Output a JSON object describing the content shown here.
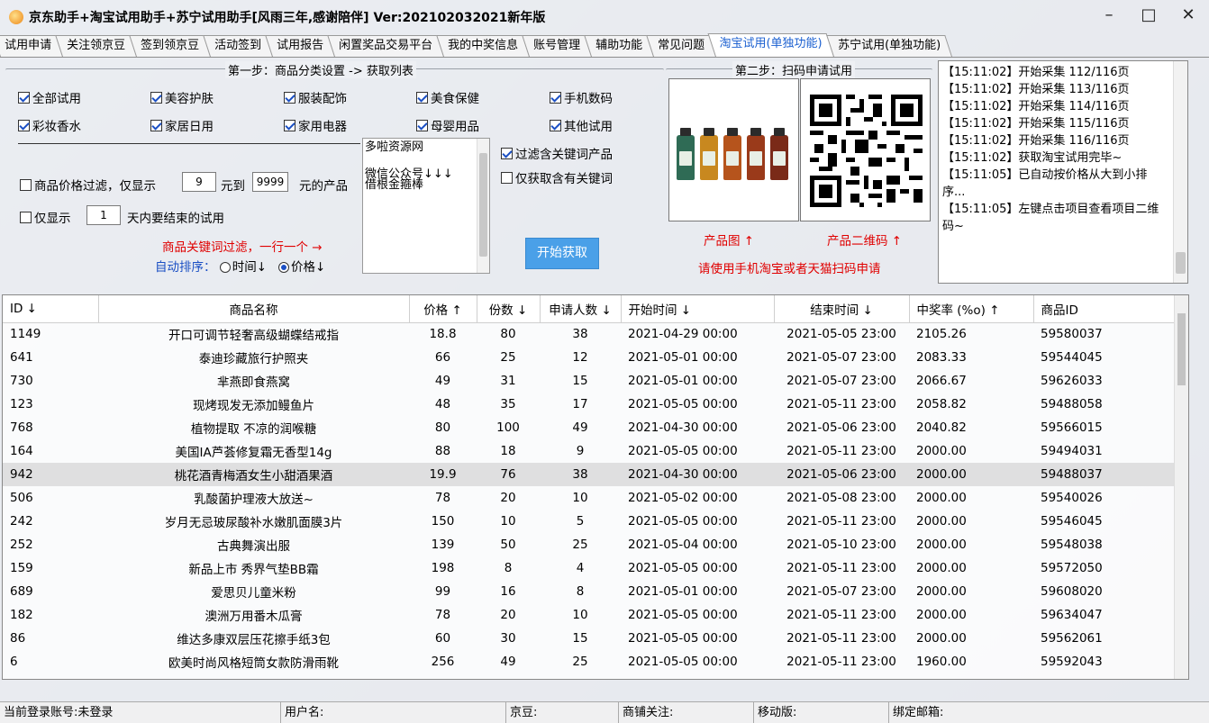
{
  "window": {
    "title": "京东助手+淘宝试用助手+苏宁试用助手[风雨三年,感谢陪伴] Ver:202102032021新年版"
  },
  "tabs": [
    {
      "label": "试用申请"
    },
    {
      "label": "关注领京豆"
    },
    {
      "label": "签到领京豆"
    },
    {
      "label": "活动签到"
    },
    {
      "label": "试用报告"
    },
    {
      "label": "闲置奖品交易平台"
    },
    {
      "label": "我的中奖信息"
    },
    {
      "label": "账号管理"
    },
    {
      "label": "辅助功能"
    },
    {
      "label": "常见问题"
    },
    {
      "label": "淘宝试用(单独功能)"
    },
    {
      "label": "苏宁试用(单独功能)"
    }
  ],
  "step1": {
    "title": "第一步：商品分类设置 -> 获取列表",
    "categories": [
      {
        "label": "全部试用",
        "checked": true
      },
      {
        "label": "美容护肤",
        "checked": true
      },
      {
        "label": "服装配饰",
        "checked": true
      },
      {
        "label": "美食保健",
        "checked": true
      },
      {
        "label": "手机数码",
        "checked": true
      },
      {
        "label": "彩妆香水",
        "checked": true
      },
      {
        "label": "家居日用",
        "checked": true
      },
      {
        "label": "家用电器",
        "checked": true
      },
      {
        "label": "母婴用品",
        "checked": true
      },
      {
        "label": "其他试用",
        "checked": true
      }
    ],
    "price_filter_label": "商品价格过滤，仅显示",
    "price_min": "9",
    "price_to": "元到",
    "price_max": "9999",
    "price_suffix": "元的产品",
    "days_label": "仅显示",
    "days_value": "1",
    "days_suffix": "天内要结束的试用",
    "keyword_hint": "商品关键词过滤，一行一个 →",
    "sort_label": "自动排序：",
    "sort_time": "时间↓",
    "sort_price": "价格↓",
    "keywords_line1": "多啦资源网",
    "keywords_line2": "微信公众号↓↓↓",
    "keywords_line3": "借根金箍棒",
    "filter_keyword": "过滤含关键词产品",
    "only_keyword": "仅获取含有关键词",
    "start_button": "开始获取"
  },
  "step2": {
    "title": "第二步：扫码申请试用",
    "product_img_label": "产品图 ↑",
    "qr_label": "产品二维码 ↑",
    "scan_hint": "请使用手机淘宝或者天猫扫码申请"
  },
  "log": [
    "【15:11:02】开始采集 112/116页",
    "【15:11:02】开始采集 113/116页",
    "【15:11:02】开始采集 114/116页",
    "【15:11:02】开始采集 115/116页",
    "【15:11:02】开始采集 116/116页",
    "【15:11:02】获取淘宝试用完毕~",
    "【15:11:05】已自动按价格从大到小排序...",
    "【15:11:05】左键点击项目查看项目二维码~"
  ],
  "table": {
    "headers": [
      "ID ↓",
      "商品名称",
      "价格 ↑",
      "份数 ↓",
      "申请人数 ↓",
      "开始时间 ↓",
      "结束时间 ↓",
      "中奖率 (%o)  ↑",
      "商品ID"
    ],
    "rows": [
      [
        "1149",
        "开口可调节轻奢高级蝴蝶结戒指",
        "18.8",
        "80",
        "38",
        "2021-04-29 00:00",
        "2021-05-05 23:00",
        "2105.26",
        "59580037"
      ],
      [
        "641",
        "泰迪珍藏旅行护照夹",
        "66",
        "25",
        "12",
        "2021-05-01 00:00",
        "2021-05-07 23:00",
        "2083.33",
        "59544045"
      ],
      [
        "730",
        "芈燕即食燕窝",
        "49",
        "31",
        "15",
        "2021-05-01 00:00",
        "2021-05-07 23:00",
        "2066.67",
        "59626033"
      ],
      [
        "123",
        "现烤现发无添加鳗鱼片",
        "48",
        "35",
        "17",
        "2021-05-05 00:00",
        "2021-05-11 23:00",
        "2058.82",
        "59488058"
      ],
      [
        "768",
        "植物提取 不凉的润喉糖",
        "80",
        "100",
        "49",
        "2021-04-30 00:00",
        "2021-05-06 23:00",
        "2040.82",
        "59566015"
      ],
      [
        "164",
        "美国IA芦荟修复霜无香型14g",
        "88",
        "18",
        "9",
        "2021-05-05 00:00",
        "2021-05-11 23:00",
        "2000.00",
        "59494031"
      ],
      [
        "942",
        "桃花酒青梅酒女生小甜酒果酒",
        "19.9",
        "76",
        "38",
        "2021-04-30 00:00",
        "2021-05-06 23:00",
        "2000.00",
        "59488037"
      ],
      [
        "506",
        "乳酸菌护理液大放送~",
        "78",
        "20",
        "10",
        "2021-05-02 00:00",
        "2021-05-08 23:00",
        "2000.00",
        "59540026"
      ],
      [
        "242",
        "岁月无忌玻尿酸补水嫩肌面膜3片",
        "150",
        "10",
        "5",
        "2021-05-05 00:00",
        "2021-05-11 23:00",
        "2000.00",
        "59546045"
      ],
      [
        "252",
        "古典舞演出服",
        "139",
        "50",
        "25",
        "2021-05-04 00:00",
        "2021-05-10 23:00",
        "2000.00",
        "59548038"
      ],
      [
        "159",
        "新品上市 秀界气垫BB霜",
        "198",
        "8",
        "4",
        "2021-05-05 00:00",
        "2021-05-11 23:00",
        "2000.00",
        "59572050"
      ],
      [
        "689",
        "爱思贝儿童米粉",
        "99",
        "16",
        "8",
        "2021-05-01 00:00",
        "2021-05-07 23:00",
        "2000.00",
        "59608020"
      ],
      [
        "182",
        "澳洲万用番木瓜膏",
        "78",
        "20",
        "10",
        "2021-05-05 00:00",
        "2021-05-11 23:00",
        "2000.00",
        "59634047"
      ],
      [
        "86",
        "维达多康双层压花擦手纸3包",
        "60",
        "30",
        "15",
        "2021-05-05 00:00",
        "2021-05-11 23:00",
        "2000.00",
        "59562061"
      ],
      [
        "6",
        "欧美时尚风格短筒女款防滑雨靴",
        "256",
        "49",
        "25",
        "2021-05-05 00:00",
        "2021-05-11 23:00",
        "1960.00",
        "59592043"
      ]
    ],
    "selected_row": 6
  },
  "statusbar": {
    "login": "当前登录账号:未登录",
    "username": "用户名:",
    "jingdou": "京豆:",
    "shop_follow": "商铺关注:",
    "mobile": "移动版:",
    "email": "绑定邮箱:"
  },
  "colors": {
    "accent_blue": "#1a4fc4",
    "warning_red": "#e00000",
    "button_blue": "#4aa0e8"
  }
}
